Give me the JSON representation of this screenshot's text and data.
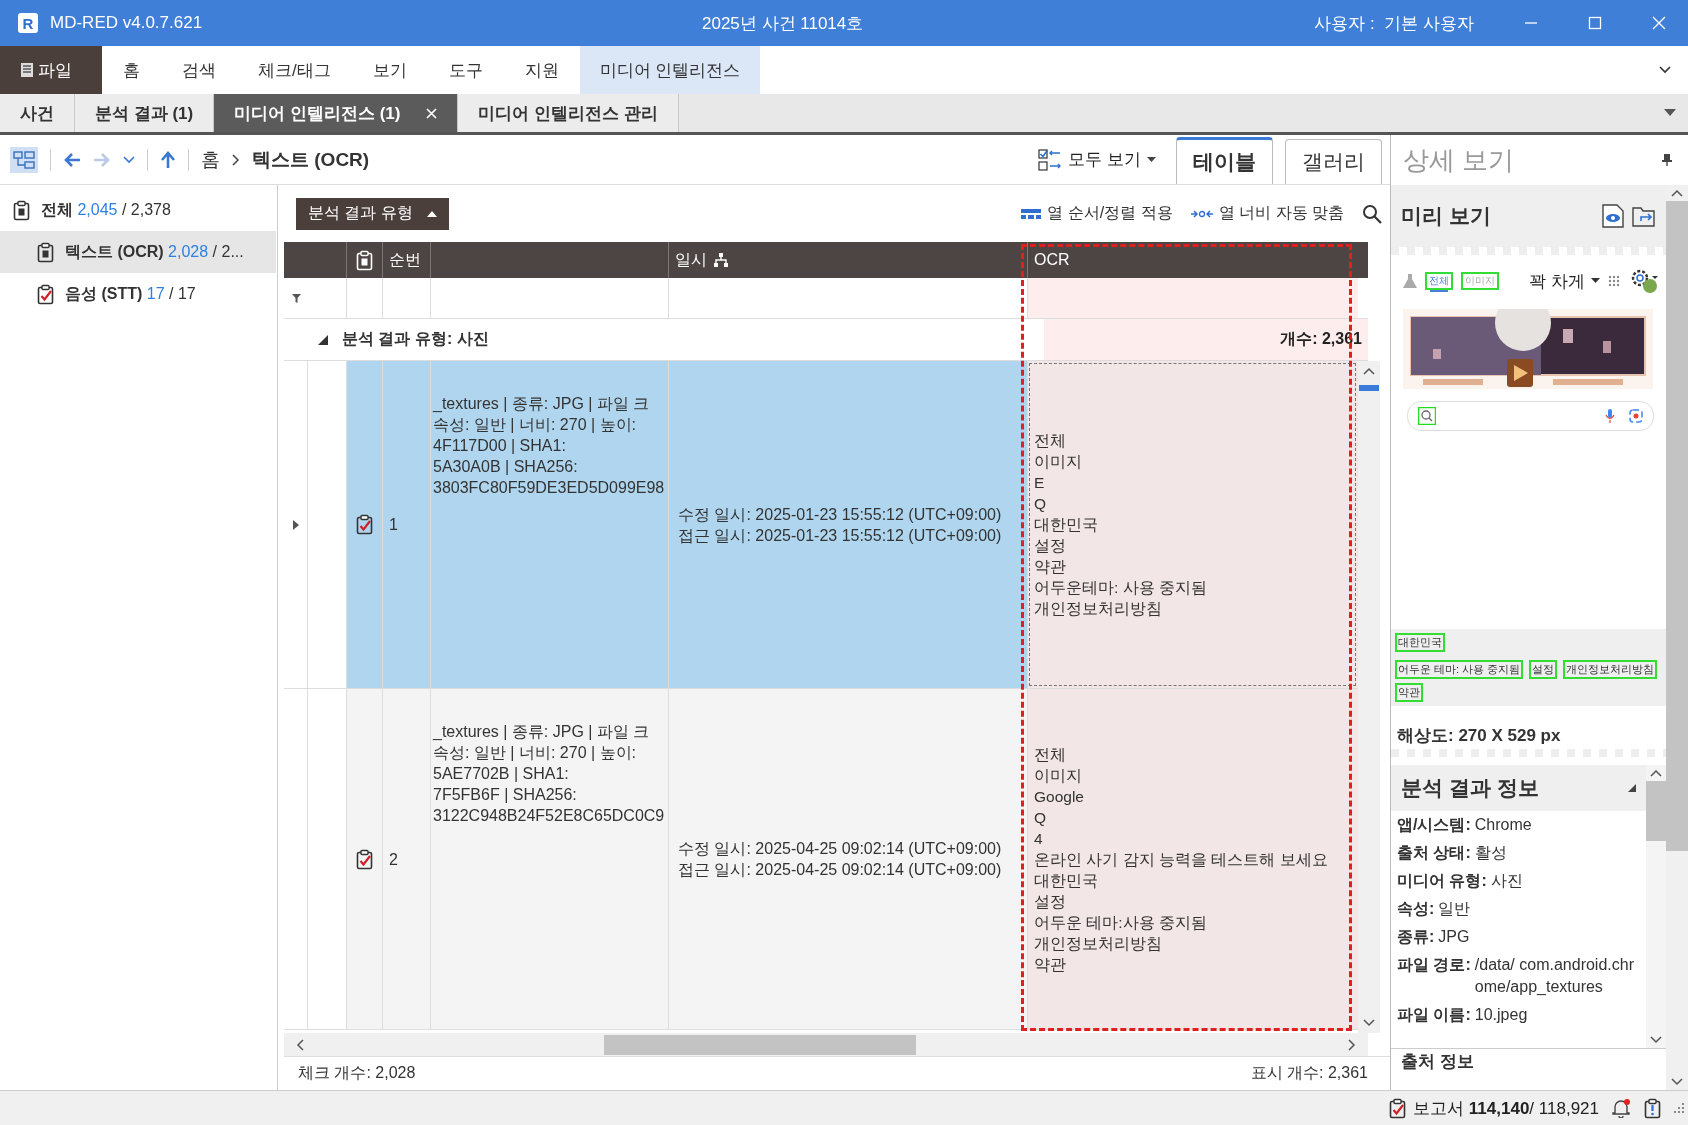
{
  "window": {
    "logo": "R",
    "app": "MD-RED v4.0.7.621",
    "title": "2025년 사건 11014호",
    "user": "사용자 :  기본 사용자"
  },
  "menu": [
    {
      "label": "파일",
      "kind": "app",
      "selected": false
    },
    {
      "label": "홈",
      "kind": "item",
      "selected": false
    },
    {
      "label": "검색",
      "kind": "item",
      "selected": false
    },
    {
      "label": "체크/태그",
      "kind": "item",
      "selected": false
    },
    {
      "label": "보기",
      "kind": "item",
      "selected": false
    },
    {
      "label": "도구",
      "kind": "item",
      "selected": false
    },
    {
      "label": "지원",
      "kind": "item",
      "selected": false
    },
    {
      "label": "미디어 인텔리전스",
      "kind": "item",
      "selected": true
    }
  ],
  "doc_tabs": [
    {
      "label": "사건",
      "selected": false,
      "closable": false
    },
    {
      "label": "분석 결과 (1)",
      "selected": false,
      "closable": false
    },
    {
      "label": "미디어 인텔리전스 (1)",
      "selected": true,
      "closable": true
    },
    {
      "label": "미디어 인텔리전스 관리",
      "selected": false,
      "closable": false
    }
  ],
  "toolbar": {
    "forward_disabled": true,
    "breadcrumb": [
      "홈",
      "텍스트 (OCR)"
    ],
    "view_all": "모두 보기",
    "view_tabs": [
      {
        "label": "테이블",
        "selected": true
      },
      {
        "label": "갤러리",
        "selected": false
      }
    ]
  },
  "tree": [
    {
      "label": "전체",
      "count": "2,045",
      "total": "/ 2,378",
      "checked": false,
      "partial": true,
      "selected": false,
      "children": [
        {
          "label": "텍스트 (OCR)",
          "count": "2,028",
          "total": "/ 2...",
          "checked": false,
          "partial": true,
          "selected": true
        },
        {
          "label": "음성 (STT)",
          "count": "17",
          "total": "/ 17",
          "checked": true,
          "partial": false,
          "selected": false
        }
      ]
    }
  ],
  "table": {
    "group_button": "분석 결과 유형",
    "actions": [
      {
        "kind": "columns",
        "label": "열 순서/정렬 적용"
      },
      {
        "kind": "autofit",
        "label": "열 너비 자동 맞춤"
      }
    ],
    "columns": [
      {
        "kind": "check"
      },
      {
        "kind": "text",
        "label": "순번"
      },
      {
        "kind": "blank"
      },
      {
        "kind": "hier",
        "label": "일시"
      },
      {
        "kind": "text",
        "label": "OCR",
        "highlighted": true
      }
    ],
    "group": {
      "label": "분석 결과 유형: 사진",
      "count": "개수: 2,361",
      "expanded": true
    },
    "rows": [
      {
        "selected": true,
        "checked": true,
        "number": "1",
        "details": [
          "_textures | 종류: JPG | 파일 크",
          "속성: 일반 | 너비: 270 | 높이:",
          "4F117D00 | SHA1:",
          "5A30A0B | SHA256:",
          "3803FC80F59DE3ED5D099E98"
        ],
        "dates": [
          "수정 일시: 2025-01-23 15:55:12 (UTC+09:00)",
          "접근 일시: 2025-01-23 15:55:12 (UTC+09:00)"
        ],
        "ocr": [
          "전체",
          "이미지",
          "E",
          "Q",
          "대한민국",
          "설정",
          "약관",
          "어두운테마: 사용 중지됨",
          "개인정보처리방침"
        ]
      },
      {
        "selected": false,
        "checked": true,
        "number": "2",
        "details": [
          "_textures | 종류: JPG | 파일 크",
          "속성: 일반 | 너비: 270 | 높이:",
          "5AE7702B | SHA1:",
          "7F5FB6F | SHA256:",
          "3122C948B24F52E8C65DC0C9"
        ],
        "dates": [
          "수정 일시: 2025-04-25 09:02:14 (UTC+09:00)",
          "접근 일시: 2025-04-25 09:02:14 (UTC+09:00)"
        ],
        "ocr": [
          "전체",
          "이미지",
          "Google",
          "Q",
          "4",
          "온라인 사기 감지 능력을 테스트해 보세요",
          "대한민국",
          "설정",
          "어두운 테마:사용 중지됨",
          "개인정보처리방침",
          "약관"
        ]
      }
    ],
    "footer": {
      "checked": "체크 개수: 2,028",
      "shown": "표시 개수: 2,361"
    }
  },
  "detail": {
    "title": "상세 보기",
    "preview_title": "미리 보기",
    "preview": {
      "tabs": [
        {
          "label": "전체",
          "selected": true
        },
        {
          "label": "이미지",
          "selected": false
        }
      ],
      "fit_mode": "꽉 차게",
      "labels_top": [
        "대한민국"
      ],
      "labels_bottom": [
        "어두운 테마: 사용 중지됨",
        "설정",
        "개인정보처리방침",
        "약관"
      ]
    },
    "resolution": "해상도: 270 X 529 px",
    "info_title": "분석 결과 정보",
    "info": [
      {
        "key": "앱/시스템:",
        "value": "Chrome"
      },
      {
        "key": "출처 상태:",
        "value": "활성"
      },
      {
        "key": "미디어 유형:",
        "value": "사진"
      },
      {
        "key": "속성:",
        "value": "일반"
      },
      {
        "key": "종류:",
        "value": "JPG"
      },
      {
        "key": "파일 경로:",
        "value": "/data/ com.android.chrome/app_textures"
      },
      {
        "key": "파일 이름:",
        "value": "10.jpeg"
      }
    ],
    "next_section": "출처 정보"
  },
  "status": {
    "label": "보고서",
    "checked": "114,140",
    "total": "/ 118,921",
    "notification": true
  }
}
